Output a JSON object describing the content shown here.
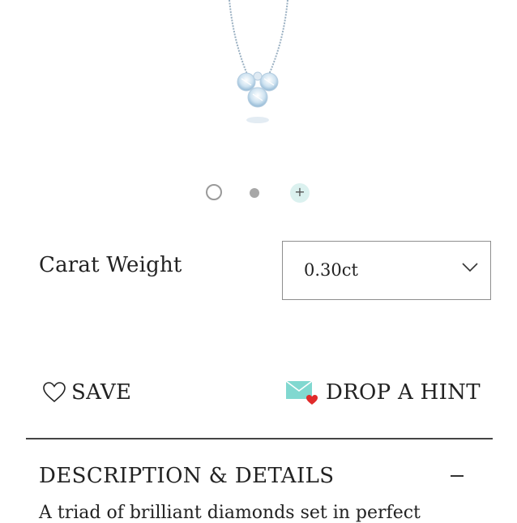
{
  "product": {
    "image_alt": "diamond pendant necklace"
  },
  "carousel": {
    "dots": [
      "image-1",
      "image-2",
      "more-images"
    ],
    "more_symbol": "+"
  },
  "options": {
    "carat_label": "Carat Weight",
    "carat_value": "0.30ct"
  },
  "actions": {
    "save_label": "SAVE",
    "hint_label": "DROP A HINT"
  },
  "description": {
    "title": "DESCRIPTION & DETAILS",
    "text": "A triad of brilliant diamonds set in perfect"
  },
  "colors": {
    "accent_teal": "#81d8d0",
    "heart_red": "#e02b2b"
  }
}
